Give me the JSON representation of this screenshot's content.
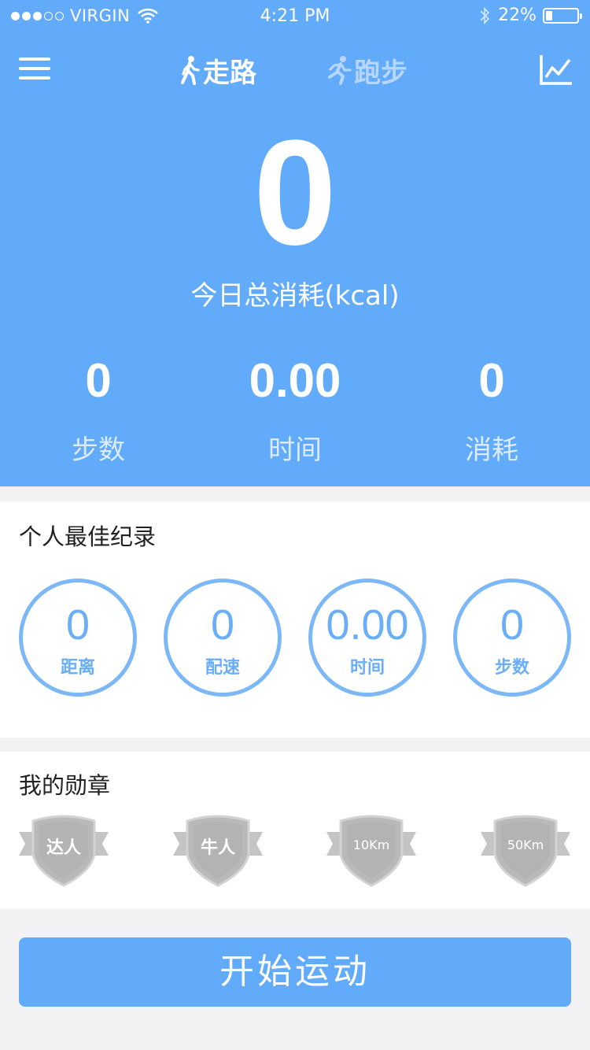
{
  "status_bar": {
    "carrier": "VIRGIN",
    "time": "4:21 PM",
    "battery_percent": "22%",
    "battery_level": 0.22,
    "signal_bars_filled": 3,
    "signal_bars_total": 5,
    "icons": [
      "wifi-icon",
      "bluetooth-icon",
      "battery-icon"
    ]
  },
  "nav": {
    "menu_icon": "hamburger-menu-icon",
    "tabs": [
      {
        "label": "走路",
        "icon": "walking-person-icon",
        "active": true
      },
      {
        "label": "跑步",
        "icon": "running-person-icon",
        "active": false
      }
    ],
    "chart_icon": "line-chart-icon"
  },
  "summary": {
    "total_value": "0",
    "total_label": "今日总消耗(kcal)",
    "stats": [
      {
        "value": "0",
        "label": "步数"
      },
      {
        "value": "0.00",
        "label": "时间"
      },
      {
        "value": "0",
        "label": "消耗"
      }
    ]
  },
  "records": {
    "title": "个人最佳纪录",
    "items": [
      {
        "value": "0",
        "label": "距离"
      },
      {
        "value": "0",
        "label": "配速"
      },
      {
        "value": "0.00",
        "label": "时间"
      },
      {
        "value": "0",
        "label": "步数"
      }
    ]
  },
  "medals": {
    "title": "我的勋章",
    "items": [
      {
        "label": "达人"
      },
      {
        "label": "牛人"
      },
      {
        "label": "10Km"
      },
      {
        "label": "50Km"
      }
    ]
  },
  "start_button": {
    "label": "开始运动"
  },
  "colors": {
    "primary": "#62abfb",
    "circle_border": "#7cb7f8",
    "medal_gray": "#b9b9b9",
    "background": "#f2f2f4"
  }
}
